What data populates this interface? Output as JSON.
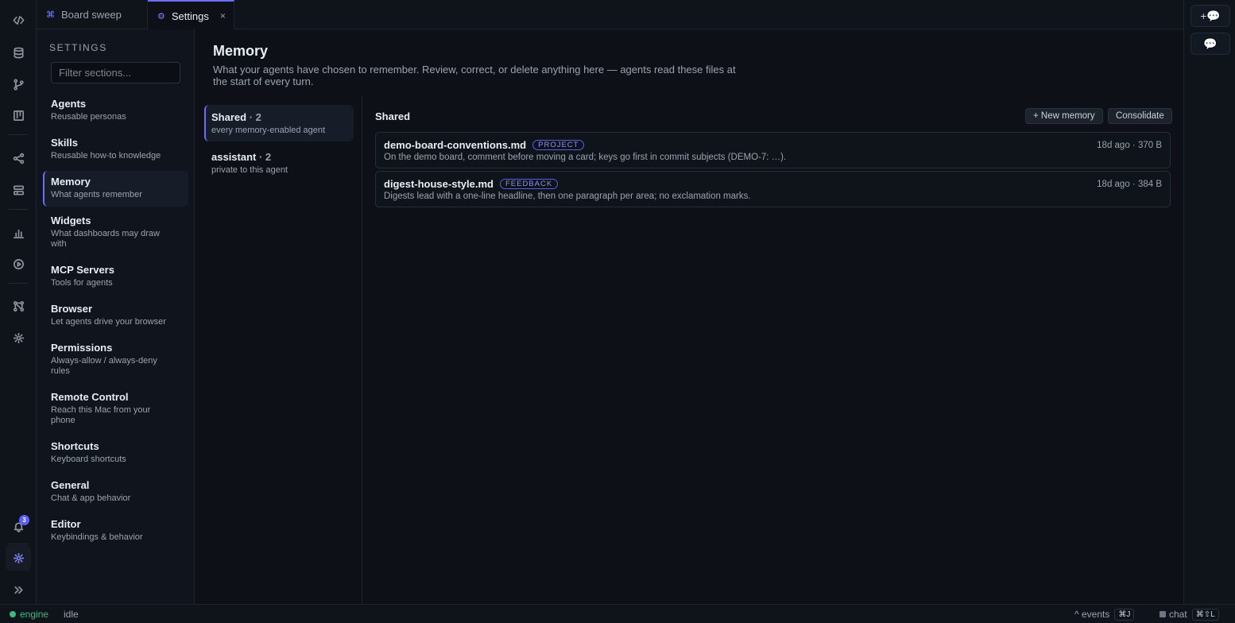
{
  "tabs": [
    {
      "icon": "⌘",
      "label": "Board sweep"
    },
    {
      "icon": "⚙",
      "label": "Settings",
      "close": "×"
    }
  ],
  "activity_icons": [
    "code-icon",
    "database-icon",
    "git-branch-icon",
    "board-icon",
    "share-icon",
    "layout-icon",
    "chart-icon",
    "play-icon",
    "workflow-icon",
    "gear-icon",
    "bell-icon",
    "settings-icon",
    "expand-icon"
  ],
  "notifications": {
    "count": "3"
  },
  "settings_nav": {
    "heading": "SETTINGS",
    "filter_placeholder": "Filter sections...",
    "items": [
      {
        "title": "Agents",
        "subtitle": "Reusable personas"
      },
      {
        "title": "Skills",
        "subtitle": "Reusable how-to knowledge"
      },
      {
        "title": "Memory",
        "subtitle": "What agents remember"
      },
      {
        "title": "Widgets",
        "subtitle": "What dashboards may draw with"
      },
      {
        "title": "MCP Servers",
        "subtitle": "Tools for agents"
      },
      {
        "title": "Browser",
        "subtitle": "Let agents drive your browser"
      },
      {
        "title": "Permissions",
        "subtitle": "Always-allow / always-deny rules"
      },
      {
        "title": "Remote Control",
        "subtitle": "Reach this Mac from your phone"
      },
      {
        "title": "Shortcuts",
        "subtitle": "Keyboard shortcuts"
      },
      {
        "title": "General",
        "subtitle": "Chat & app behavior"
      },
      {
        "title": "Editor",
        "subtitle": "Keybindings & behavior"
      }
    ]
  },
  "memory": {
    "title": "Memory",
    "description": "What your agents have chosen to remember. Review, correct, or delete anything here — agents read these files at the start of every turn.",
    "scopes": [
      {
        "name": "Shared",
        "count": " · 2",
        "subtitle": "every memory-enabled agent"
      },
      {
        "name": "assistant",
        "count": " · 2",
        "subtitle": "private to this agent"
      }
    ],
    "detail": {
      "title": "Shared",
      "new_button": "+ New memory",
      "consolidate_button": "Consolidate",
      "entries": [
        {
          "name": "demo-board-conventions.md",
          "tag": "PROJECT",
          "meta": "18d ago · 370 B",
          "text": "On the demo board, comment before moving a card; keys go first in commit subjects (DEMO-7: …)."
        },
        {
          "name": "digest-house-style.md",
          "tag": "FEEDBACK",
          "meta": "18d ago · 384 B",
          "text": "Digests lead with a one-line headline, then one paragraph per area; no exclamation marks."
        }
      ]
    }
  },
  "right_rail": {
    "new_chat_icon": "+💬",
    "chat_icon": "💬"
  },
  "status_bar": {
    "engine": "engine",
    "state": "idle",
    "events_label": "^ events",
    "events_kbd": "⌘J",
    "chat_label": "chat",
    "chat_kbd": "⌘⇧L"
  }
}
